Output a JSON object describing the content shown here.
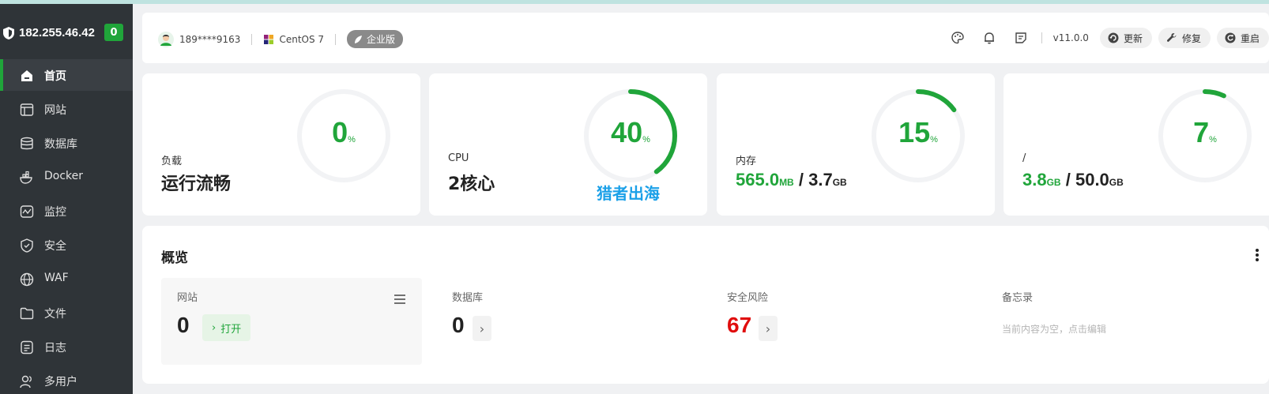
{
  "sidebar": {
    "ip": "182.255.46.42",
    "badge": "0",
    "items": [
      {
        "label": "首页"
      },
      {
        "label": "网站"
      },
      {
        "label": "数据库"
      },
      {
        "label": "Docker"
      },
      {
        "label": "监控"
      },
      {
        "label": "安全"
      },
      {
        "label": "WAF"
      },
      {
        "label": "文件"
      },
      {
        "label": "日志"
      },
      {
        "label": "多用户"
      }
    ]
  },
  "header": {
    "user": "189****9163",
    "os": "CentOS 7",
    "edition": "企业版",
    "version": "v11.0.0",
    "update_label": "更新",
    "repair_label": "修复",
    "restart_label": "重启"
  },
  "stats": {
    "load": {
      "label": "负载",
      "value": "运行流畅",
      "percent": 0,
      "unit": "%"
    },
    "cpu": {
      "label": "CPU",
      "value": "2核心",
      "percent": 40,
      "unit": "%"
    },
    "memory": {
      "label": "内存",
      "used": "565.0",
      "used_unit": "MB",
      "slash": "/",
      "total": "3.7",
      "total_unit": "GB",
      "percent": 15,
      "unit": "%"
    },
    "disk": {
      "label": "/",
      "used": "3.8",
      "used_unit": "GB",
      "slash": "/",
      "total": "50.0",
      "total_unit": "GB",
      "percent": 7,
      "unit": "%"
    }
  },
  "watermark": "猎者出海",
  "overview": {
    "title": "概览",
    "site": {
      "label": "网站",
      "count": "0",
      "open_label": "打开"
    },
    "database": {
      "label": "数据库",
      "count": "0"
    },
    "risk": {
      "label": "安全风险",
      "count": "67"
    },
    "memo": {
      "label": "备忘录",
      "placeholder": "当前内容为空，点击编辑"
    }
  },
  "colors": {
    "accent": "#20a53a",
    "danger": "#e00d0d",
    "sidebar": "#2f3438"
  }
}
